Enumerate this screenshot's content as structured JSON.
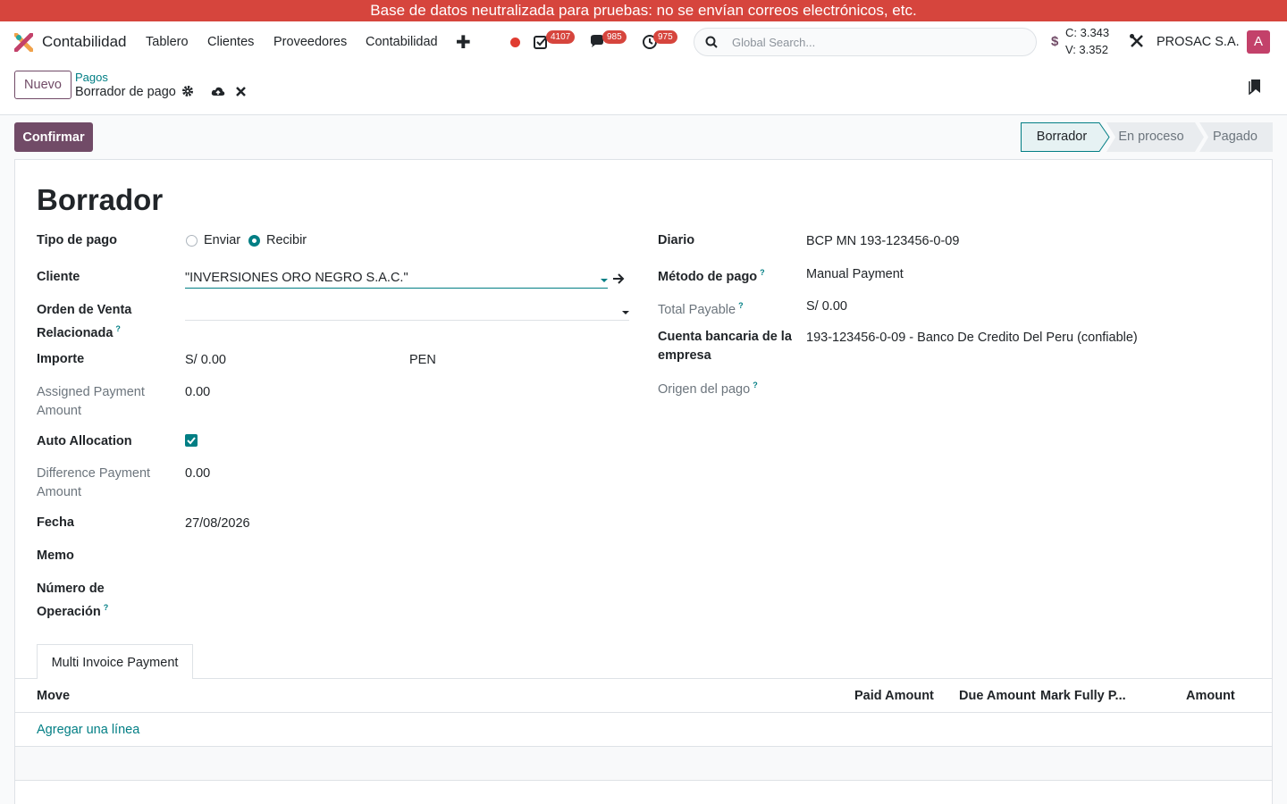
{
  "banner": "Base de datos neutralizada para pruebas: no se envían correos electrónicos, etc.",
  "navbar": {
    "app_name": "Contabilidad",
    "menu": [
      "Tablero",
      "Clientes",
      "Proveedores",
      "Contabilidad"
    ],
    "badges": {
      "activities": "4107",
      "messages": "985",
      "timer": "975"
    },
    "search_placeholder": "Global Search...",
    "rate_symbol": "$",
    "rate_buy": "C: 3.343",
    "rate_sell": "V: 3.352",
    "company": "PROSAC S.A.",
    "avatar": "A"
  },
  "control": {
    "new_label": "Nuevo",
    "breadcrumb_parent": "Pagos",
    "breadcrumb_current": "Borrador de pago"
  },
  "status": {
    "confirm_label": "Confirmar",
    "stages": [
      "Borrador",
      "En proceso",
      "Pagado"
    ],
    "active_stage": "Borrador"
  },
  "form": {
    "title": "Borrador",
    "labels": {
      "payment_type": "Tipo de pago",
      "customer": "Cliente",
      "sale_order": "Orden de Venta Relacionada",
      "amount": "Importe",
      "assigned": "Assigned Payment Amount",
      "auto_alloc": "Auto Allocation",
      "difference": "Difference Payment Amount",
      "date": "Fecha",
      "memo": "Memo",
      "operation": "Número de Operación",
      "journal": "Diario",
      "method": "Método de pago",
      "total_payable": "Total Payable",
      "bank_account": "Cuenta bancaria de la empresa",
      "origin": "Origen del pago"
    },
    "payment_type_options": [
      "Enviar",
      "Recibir"
    ],
    "payment_type_selected": "Recibir",
    "customer": "\"INVERSIONES ORO NEGRO S.A.C.\"",
    "amount": "S/ 0.00",
    "currency": "PEN",
    "assigned": "0.00",
    "auto_allocation": true,
    "difference": "0.00",
    "date": "27/08/2026",
    "journal": "BCP MN 193-123456-0-09",
    "method": "Manual Payment",
    "total_payable": "S/ 0.00",
    "bank_account": "193-123456-0-09 - Banco De Credito Del Peru (confiable)"
  },
  "tabs": {
    "multi_invoice": "Multi Invoice Payment",
    "columns": [
      "Move",
      "Paid Amount",
      "Due Amount",
      "Mark Fully P...",
      "Amount"
    ],
    "add_line": "Agregar una línea"
  },
  "colors": {
    "banner": "#d6453d",
    "primary": "#714b67",
    "accent": "#017e84"
  }
}
